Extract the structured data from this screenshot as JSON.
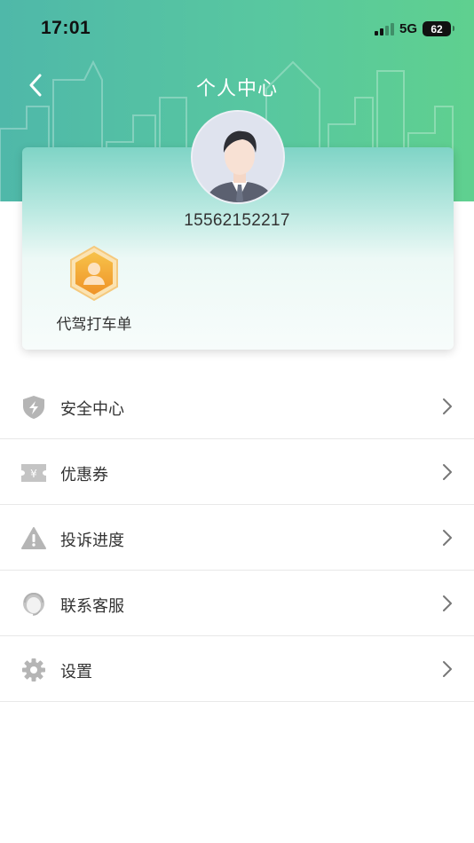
{
  "status_bar": {
    "time": "17:01",
    "network": "5G",
    "battery": "62"
  },
  "nav": {
    "title": "个人中心",
    "back_icon": "chevron-left-icon"
  },
  "profile": {
    "phone": "15562152217",
    "avatar_icon": "user-avatar-icon",
    "services": [
      {
        "label": "代驾打车单",
        "icon": "driver-order-icon"
      }
    ]
  },
  "menu": {
    "items": [
      {
        "label": "安全中心",
        "icon": "shield-bolt-icon"
      },
      {
        "label": "优惠券",
        "icon": "coupon-icon"
      },
      {
        "label": "投诉进度",
        "icon": "warning-icon"
      },
      {
        "label": "联系客服",
        "icon": "headset-icon"
      },
      {
        "label": "设置",
        "icon": "gear-icon"
      }
    ]
  },
  "colors": {
    "header_start": "#4fb8a9",
    "header_end": "#5fd08f",
    "badge": "#f2a43a",
    "icon_gray": "#b5b5b5"
  }
}
